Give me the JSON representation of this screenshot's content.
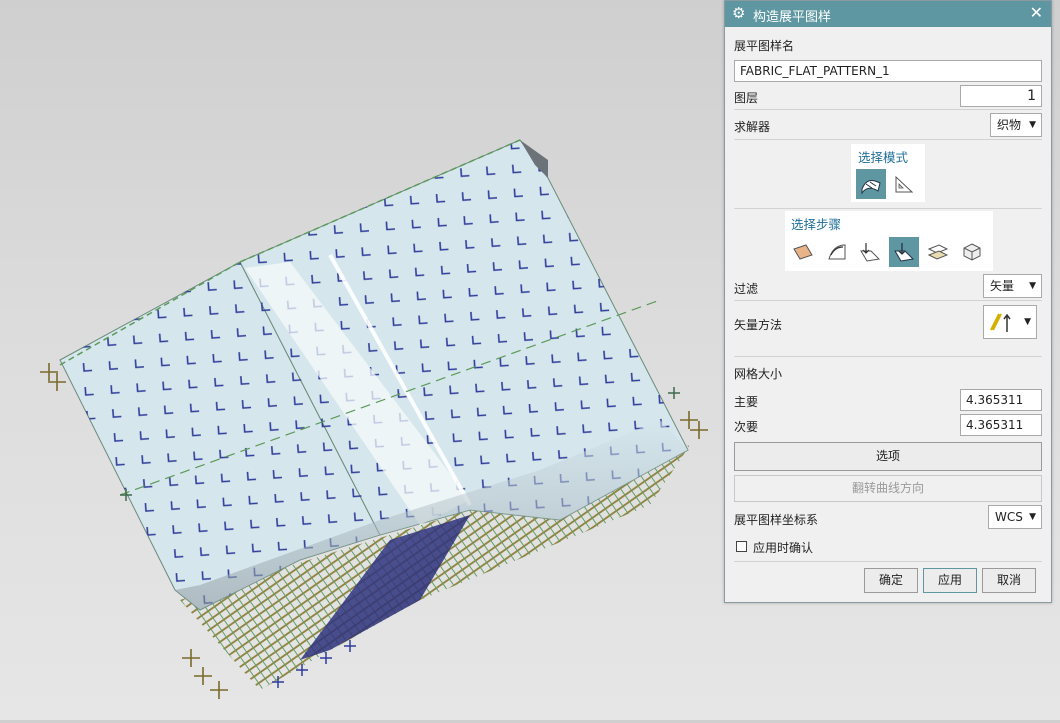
{
  "dialog": {
    "title": "构造展平图样",
    "close_glyph": "✕",
    "gear_glyph": "⚙",
    "pattern_name_label": "展平图样名",
    "pattern_name_value": "FABRIC_FLAT_PATTERN_1",
    "layer_label": "图层",
    "layer_value": "1",
    "solver_label": "求解器",
    "solver_value": "织物",
    "select_mode_title": "选择模式",
    "select_mode_icons": [
      "surface-mode-icon",
      "triangle-mode-icon"
    ],
    "select_steps_title": "选择步骤",
    "select_steps_icons": [
      "surface-step-icon",
      "curve-step-icon",
      "point-step-icon",
      "vector-step-icon",
      "layers-step-icon",
      "box-step-icon"
    ],
    "filter_label": "过滤",
    "filter_value": "矢量",
    "vector_method_label": "矢量方法",
    "mesh_size_label": "网格大小",
    "primary_label": "主要",
    "primary_value": "4.365311",
    "secondary_label": "次要",
    "secondary_value": "4.365311",
    "options_button": "选项",
    "reverse_curve_button": "翻转曲线方向",
    "csys_label": "展平图样坐标系",
    "csys_value": "WCS",
    "confirm_on_apply_label": "应用时确认",
    "confirm_on_apply_checked": false,
    "ok_button": "确定",
    "apply_button": "应用",
    "cancel_button": "取消"
  },
  "colors": {
    "titlebar": "#5e97a1",
    "selected_icon_bg": "#5e97a1",
    "group_title": "#1f6f9a",
    "surface": "#d5e6ec",
    "mesh_blue": "#2f3c9c",
    "mesh_green": "#5c9a5a",
    "mesh_olive": "#8a7a32"
  }
}
